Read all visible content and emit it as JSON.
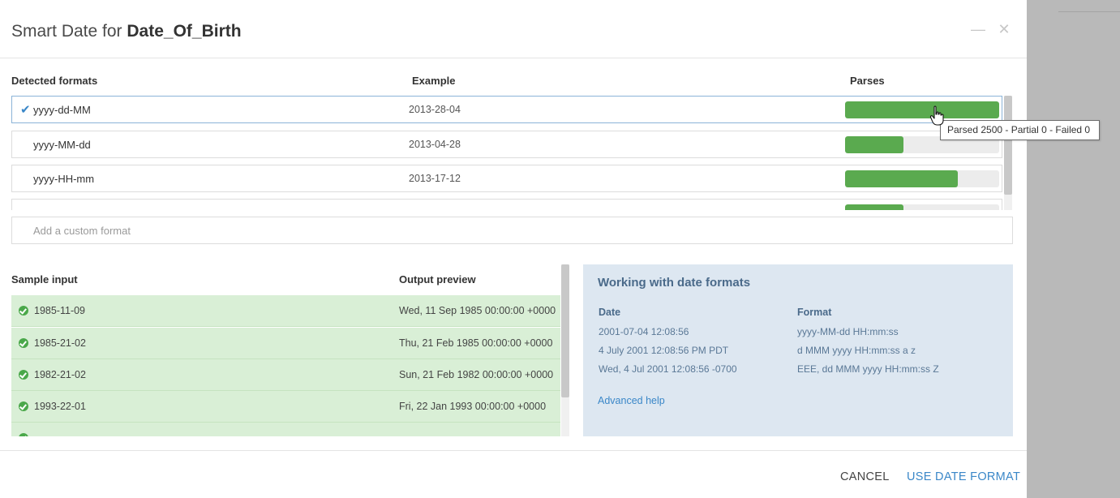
{
  "dialog": {
    "title_prefix": "Smart Date for ",
    "title_field": "Date_Of_Birth",
    "minimize_icon": "minimize-icon",
    "close_icon": "close-icon"
  },
  "formats": {
    "headers": {
      "format": "Detected formats",
      "example": "Example",
      "parses": "Parses"
    },
    "rows": [
      {
        "format": "yyyy-dd-MM",
        "example": "2013-28-04",
        "parse_fraction": 1.0,
        "selected": true
      },
      {
        "format": "yyyy-MM-dd",
        "example": "2013-04-28",
        "parse_fraction": 0.38,
        "selected": false
      },
      {
        "format": "yyyy-HH-mm",
        "example": "2013-17-12",
        "parse_fraction": 0.73,
        "selected": false
      },
      {
        "format": "",
        "example": "",
        "parse_fraction": 0.38,
        "selected": false
      }
    ],
    "tooltip": "Parsed 2500 - Partial 0 - Failed 0",
    "custom_placeholder": "Add a custom format"
  },
  "samples": {
    "headers": {
      "input": "Sample input",
      "output": "Output preview"
    },
    "rows": [
      {
        "input": "1985-11-09",
        "output": "Wed, 11 Sep 1985 00:00:00 +0000"
      },
      {
        "input": "1985-21-02",
        "output": "Thu, 21 Feb 1985 00:00:00 +0000"
      },
      {
        "input": "1982-21-02",
        "output": "Sun, 21 Feb 1982 00:00:00 +0000"
      },
      {
        "input": "1993-22-01",
        "output": "Fri, 22 Jan 1993 00:00:00 +0000"
      },
      {
        "input": "",
        "output": ""
      }
    ]
  },
  "info": {
    "title": "Working with date formats",
    "headers": {
      "date": "Date",
      "format": "Format"
    },
    "rows": [
      {
        "date": "2001-07-04 12:08:56",
        "format": "yyyy-MM-dd HH:mm:ss"
      },
      {
        "date": "4 July 2001 12:08:56 PM PDT",
        "format": "d MMM yyyy HH:mm:ss a z"
      },
      {
        "date": "Wed, 4 Jul 2001 12:08:56 -0700",
        "format": "EEE, dd MMM yyyy HH:mm:ss Z"
      }
    ],
    "link": "Advanced help"
  },
  "footer": {
    "cancel_label": "CANCEL",
    "use_label": "USE DATE FORMAT"
  },
  "colors": {
    "accent": "#3a87c8",
    "parse_bar": "#5aaa4f",
    "sample_row_bg": "#d9efd6",
    "info_bg": "#dde7f1"
  }
}
